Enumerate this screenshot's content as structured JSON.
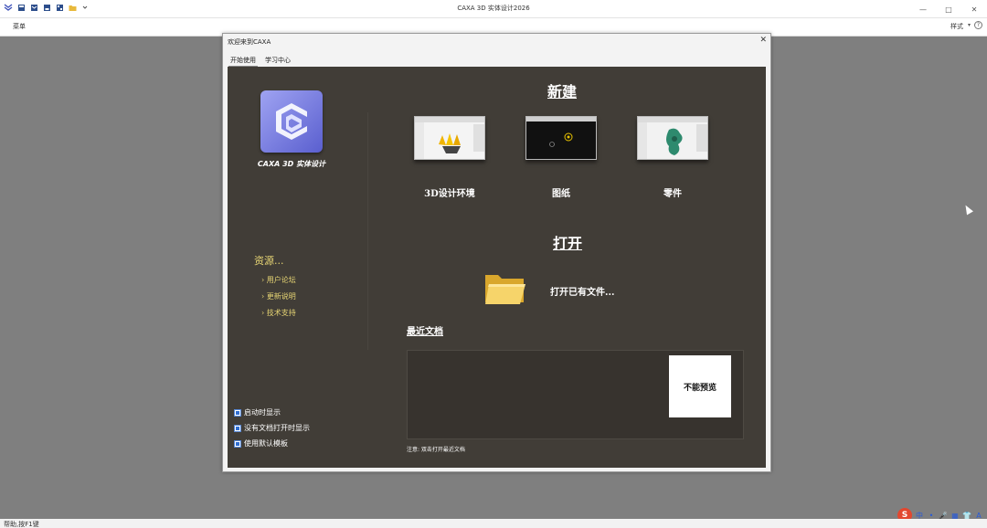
{
  "app": {
    "title": "CAXA 3D 实体设计2026",
    "window_controls": [
      "—",
      "□",
      "✕"
    ]
  },
  "menubar": {
    "menu_label": "菜单",
    "style_label": "样式",
    "chevron": "▾",
    "help": "?"
  },
  "statusbar": {
    "text": "帮助,按F1键"
  },
  "dialog": {
    "title": "欢迎来到CAXA",
    "close": "✕",
    "tabs": [
      {
        "label": "开始使用",
        "active": true
      },
      {
        "label": "学习中心",
        "active": false
      }
    ],
    "product_name": "CAXA 3D 实体设计",
    "resources": {
      "title": "资源...",
      "links": [
        "› 用户论坛",
        "› 更新说明",
        "› 技术支持"
      ]
    },
    "options": [
      {
        "label": "启动时显示",
        "checked": true
      },
      {
        "label": "没有文档打开时显示",
        "checked": true
      },
      {
        "label": "使用默认模板",
        "checked": true
      }
    ],
    "new_section": {
      "title": "新建",
      "items": [
        "3D设计环境",
        "图纸",
        "零件"
      ]
    },
    "open_section": {
      "title": "打开",
      "open_existing": "打开已有文件..."
    },
    "recent": {
      "title": "最近文档",
      "preview_text": "不能预览",
      "note": "注意: 双击打开最近文档"
    }
  },
  "ime": {
    "logo": "S",
    "icons": [
      "中",
      "•",
      "🎤",
      "▦",
      "👕",
      "A"
    ]
  },
  "colors": {
    "panel_bg": "#413d37",
    "accent_yellow": "#e8d674",
    "logo_blue": "#6a6fdc"
  }
}
